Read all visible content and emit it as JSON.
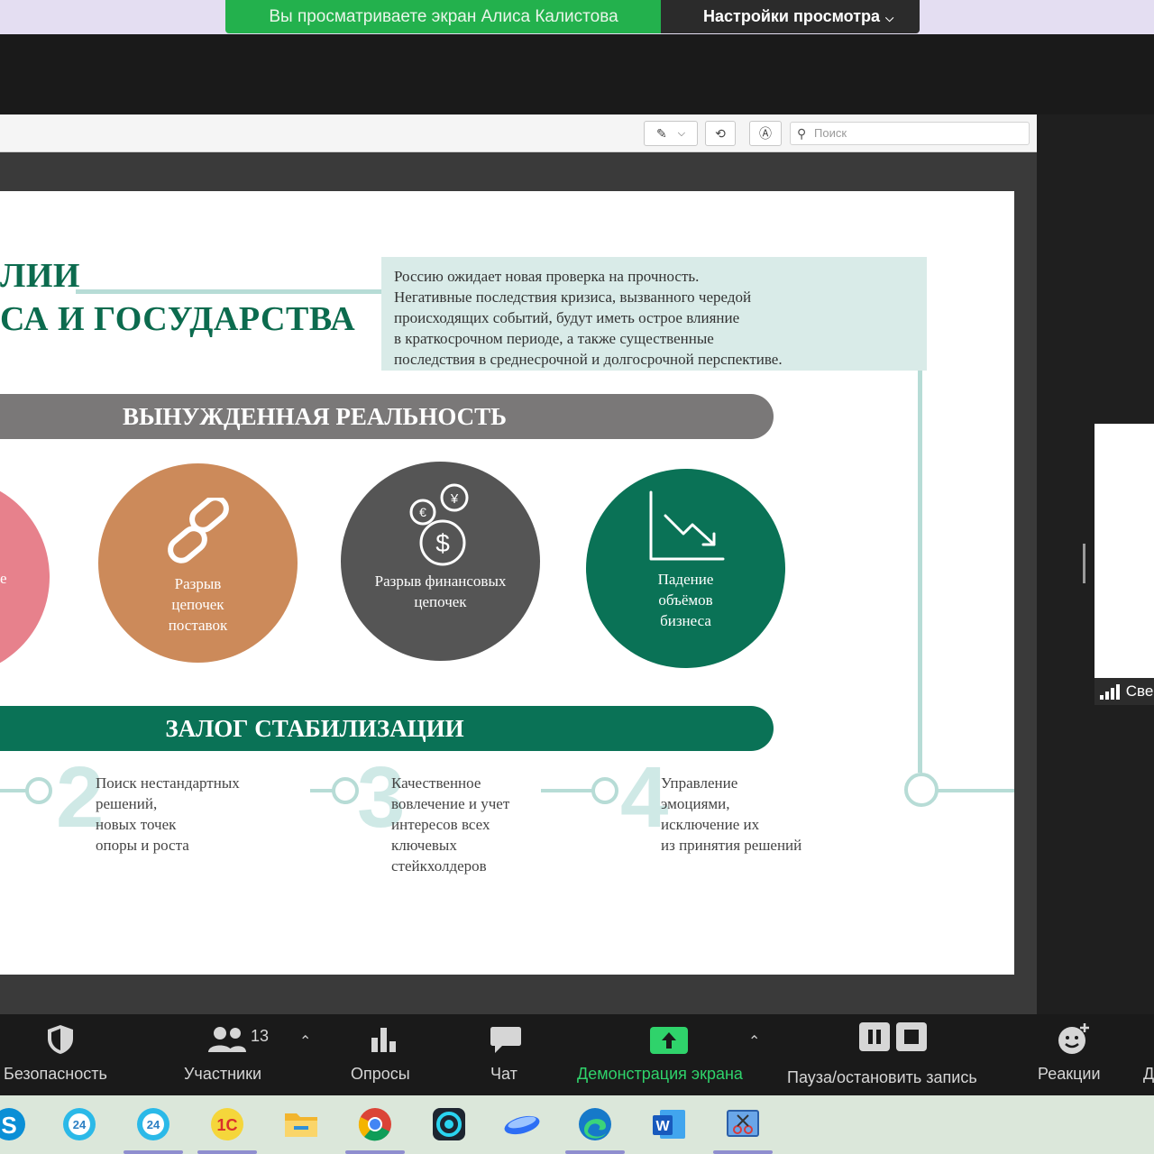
{
  "banner": {
    "sharing_text": "Вы просматриваете экран Алиса Калистова",
    "view_options": "Настройки просмотра"
  },
  "viewer": {
    "search_placeholder": "Поиск"
  },
  "slide": {
    "title_line1": "ЛИИ",
    "title_line2": "СА И ГОСУДАРСТВА",
    "info_lines": [
      "Россию ожидает новая проверка на прочность.",
      "Негативные последствия кризиса, вызванного чередой",
      "происходящих событий, будут иметь острое влияние",
      "в краткосрочном периоде, а также существенные",
      "последствия в среднесрочной и долгосрочной перспективе."
    ],
    "band1": "ВЫНУЖДЕННАЯ РЕАЛЬНОСТЬ",
    "band2": "ЗАЛОГ СТАБИЛИЗАЦИИ",
    "pink_stub": "е",
    "circles": [
      {
        "lines": [
          "Разрыв",
          "цепочек",
          "поставок"
        ]
      },
      {
        "lines": [
          "Разрыв финансовых",
          "цепочек"
        ]
      },
      {
        "lines": [
          "Падение",
          "объёмов",
          "бизнеса"
        ]
      }
    ],
    "steps": [
      {
        "num": "2",
        "lines": [
          "Поиск нестандартных",
          "решений,",
          "новых точек",
          "опоры и роста"
        ]
      },
      {
        "num": "3",
        "lines": [
          "Качественное",
          "вовлечение и учет",
          "интересов всех",
          "ключевых",
          "стейкхолдеров"
        ]
      },
      {
        "num": "4",
        "lines": [
          "Управление",
          "эмоциями,",
          "исключение их",
          "из принятия решений"
        ]
      }
    ]
  },
  "side_participant": {
    "name": "Све"
  },
  "toolbar": {
    "security": "Безопасность",
    "participants": "Участники",
    "participants_count": "13",
    "polls": "Опросы",
    "chat": "Чат",
    "share": "Демонстрация экрана",
    "record": "Пауза/остановить запись",
    "reactions": "Реакции",
    "more": "Д"
  },
  "taskbar": {
    "apps": [
      "skype-icon",
      "bitrix24-icon",
      "bitrix24-icon",
      "1c-icon",
      "file-explorer-icon",
      "chrome-icon",
      "camera-icon",
      "yandex-disk-icon",
      "edge-icon",
      "word-icon",
      "snipping-tool-icon"
    ]
  },
  "colors": {
    "green_dark": "#0a7256",
    "mint": "#b7dcd6",
    "share_green": "#23b14d",
    "orange": "#cc8a5a",
    "pink": "#e7818c",
    "grey": "#555555"
  }
}
